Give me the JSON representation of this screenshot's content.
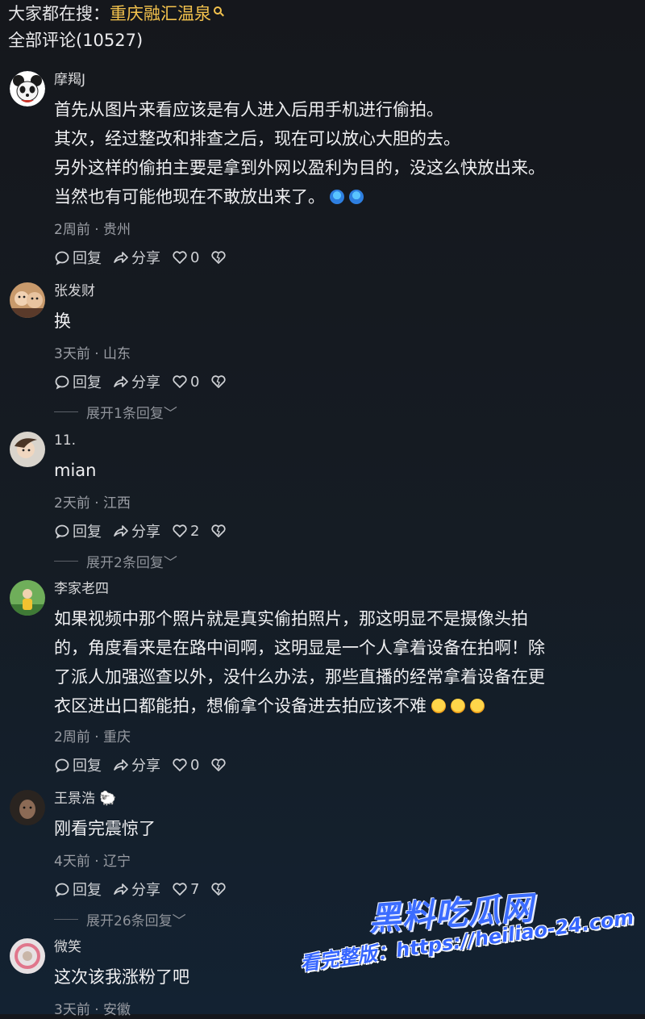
{
  "header": {
    "hot_search_prefix": "大家都在搜：",
    "hot_search_keyword": "重庆融汇温泉",
    "comment_total": "全部评论(10527)"
  },
  "actions_labels": {
    "reply": "回复",
    "share": "分享"
  },
  "comments": [
    {
      "user": "摩羯J",
      "lines": [
        "首先从图片来看应该是有人进入后用手机进行偷拍。",
        "其次，经过整改和排查之后，现在可以放心大胆的去。",
        "另外这样的偷拍主要是拿到外网以盈利为目的，没这么快放出来。",
        "当然也有可能他现在不敢放出来了。"
      ],
      "meta": "2周前 · 贵州",
      "likes": "0"
    },
    {
      "user": "张发财",
      "lines": [
        "换"
      ],
      "meta": "3天前 · 山东",
      "likes": "0",
      "expand": "展开1条回复"
    },
    {
      "user": "11.",
      "lines": [
        "mian"
      ],
      "meta": "2天前 · 江西",
      "likes": "2",
      "expand": "展开2条回复"
    },
    {
      "user": "李家老四",
      "lines": [
        "如果视频中那个照片就是真实偷拍照片，那这明显不是摄像头拍",
        "的，角度看来是在路中间啊，这明显是一个人拿着设备在拍啊！除",
        "了派人加强巡查以外，没什么办法，那些直播的经常拿着设备在更",
        "衣区进出口都能拍，想偷拿个设备进去拍应该不难"
      ],
      "meta": "2周前 · 重庆",
      "likes": "0"
    },
    {
      "user": "王景浩",
      "lines": [
        "刚看完震惊了"
      ],
      "meta": "4天前 · 辽宁",
      "likes": "7",
      "expand": "展开26条回复"
    },
    {
      "user": "微笑",
      "lines": [
        "这次该我涨粉了吧"
      ],
      "meta": "3天前 · 安徽"
    }
  ],
  "watermark": {
    "brand": "黑料吃瓜网",
    "url": "看完整版：https://heiliao-24.com"
  },
  "icons": [
    "search-icon",
    "comment-icon",
    "share-icon",
    "heart-icon",
    "dislike-heart-icon",
    "chevron-down-icon"
  ],
  "colors": {
    "keyword": "#f3c24d",
    "watermark": "#3766ff"
  }
}
